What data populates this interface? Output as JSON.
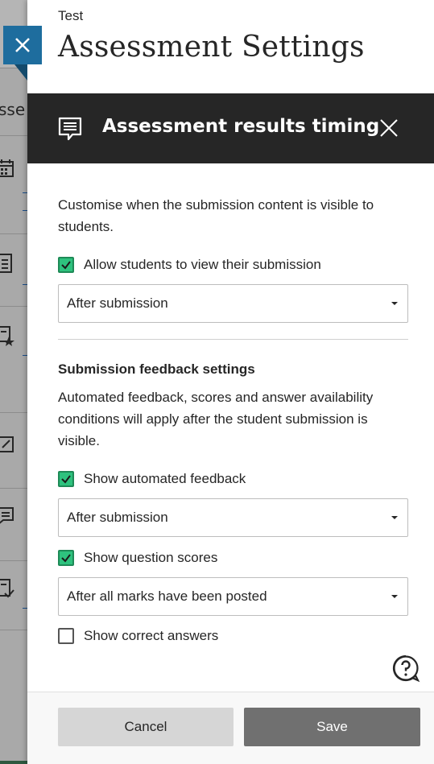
{
  "background": {
    "partial_text": "sse"
  },
  "panel": {
    "subtitle": "Test",
    "title": "Assessment Settings"
  },
  "subpanel": {
    "title": "Assessment results timing",
    "description": "Customise when the submission content is visible to students.",
    "allow_view": {
      "label": "Allow students to view their submission",
      "checked": true,
      "selected": "After submission"
    },
    "feedback": {
      "heading": "Submission feedback settings",
      "description": "Automated feedback, scores and answer availability conditions will apply after the student submission is visible.",
      "automated_feedback": {
        "label": "Show automated feedback",
        "checked": true,
        "selected": "After submission"
      },
      "question_scores": {
        "label": "Show question scores",
        "checked": true,
        "selected": "After all marks have been posted"
      },
      "correct_answers": {
        "label": "Show correct answers",
        "checked": false
      }
    }
  },
  "footer": {
    "cancel_label": "Cancel",
    "save_label": "Save"
  },
  "colors": {
    "accent_blue": "#1e6d9e",
    "header_dark": "#262626",
    "checkbox_green": "#2ec27e",
    "save_button": "#707070"
  }
}
